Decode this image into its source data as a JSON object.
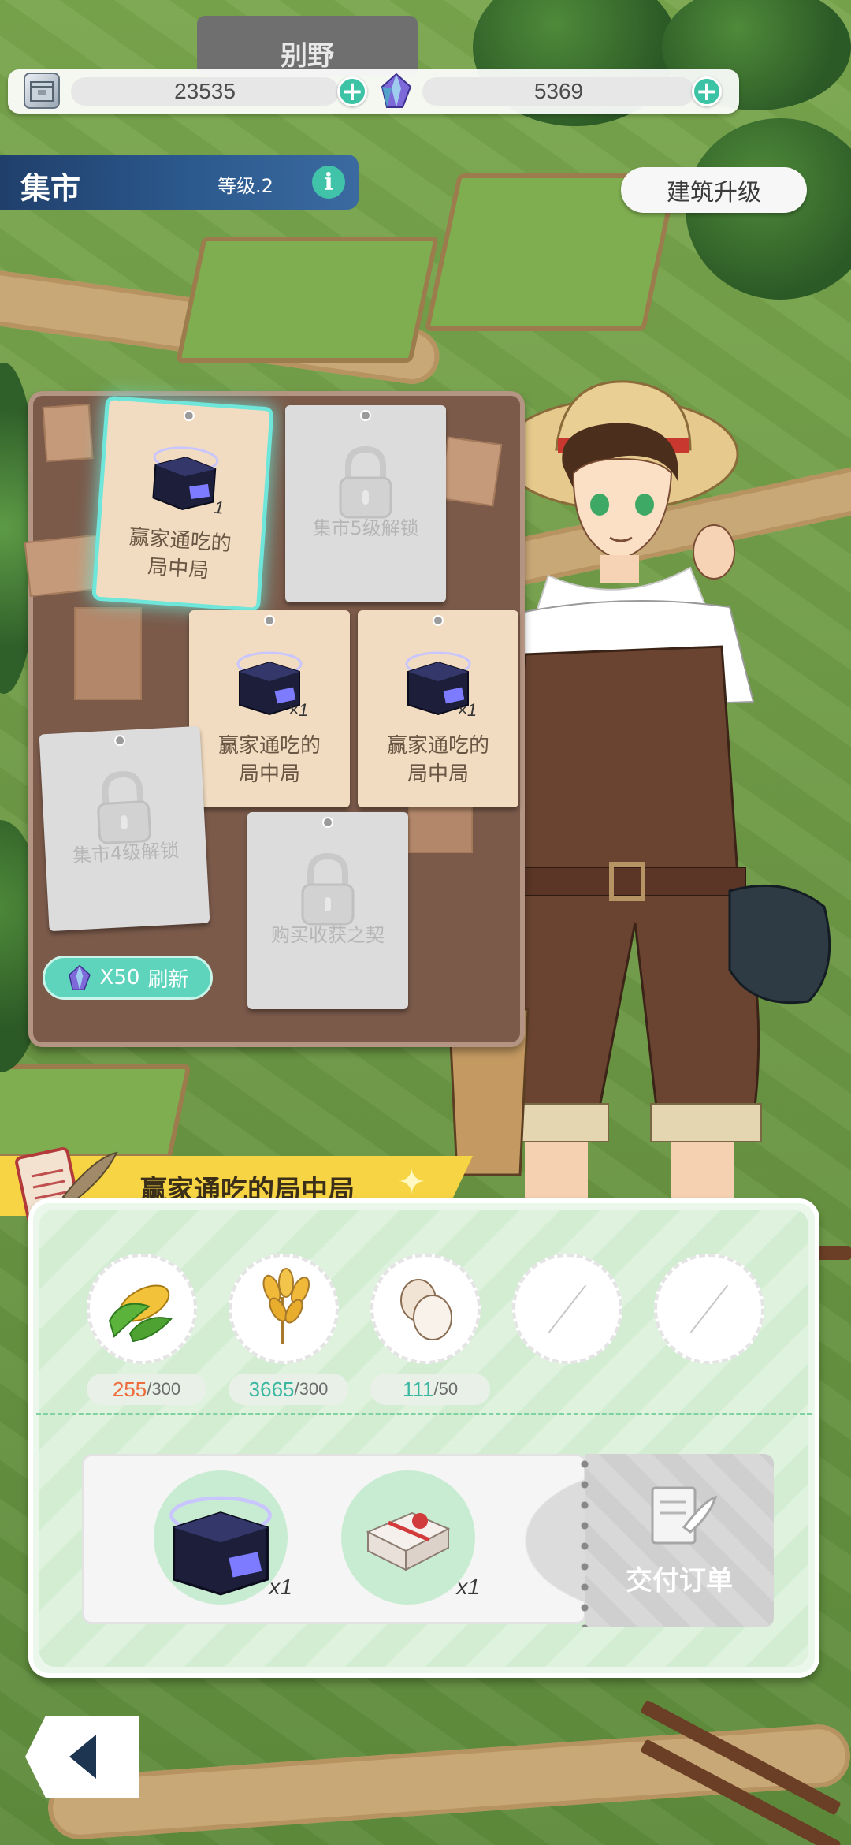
{
  "resources": {
    "boxes": {
      "value": "23535",
      "icon": "storage-box-icon"
    },
    "crystals": {
      "value": "5369",
      "icon": "crystal-icon"
    }
  },
  "location": {
    "name": "集市",
    "level": "等级.2",
    "info_icon": "i"
  },
  "header_sign": "别野",
  "upgrade_button": "建筑升级",
  "board": {
    "cards": [
      {
        "label": "赢家通吃的局中局",
        "qty": "1",
        "state": "selected"
      },
      {
        "label": "集市5级解锁",
        "state": "locked"
      },
      {
        "label": "赢家通吃的局中局",
        "qty": "×1",
        "state": "open"
      },
      {
        "label": "赢家通吃的局中局",
        "qty": "×1",
        "state": "open"
      },
      {
        "label": "集市4级解锁",
        "state": "locked"
      },
      {
        "label": "购买收获之契",
        "state": "locked"
      }
    ],
    "refresh": {
      "cost": "X50",
      "label": "刷新"
    }
  },
  "order": {
    "title": "赢家通吃的局中局",
    "requirements": [
      {
        "item": "corn-icon",
        "have": "255",
        "need": "/300",
        "have_color": "#ef6b3a"
      },
      {
        "item": "wheat-icon",
        "have": "3665",
        "need": "/300",
        "have_color": "#39b7a0"
      },
      {
        "item": "egg-icon",
        "have": "111",
        "need": "/50",
        "have_color": "#39b7a0"
      },
      {
        "item": "empty-slot",
        "have": "",
        "need": ""
      },
      {
        "item": "empty-slot",
        "have": "",
        "need": ""
      }
    ],
    "rewards": [
      {
        "item": "mystery-gift-box-icon",
        "qty": "x1"
      },
      {
        "item": "wrapped-package-icon",
        "qty": "x1"
      }
    ],
    "deliver_button": "交付订单"
  },
  "colors": {
    "accent_teal": "#3cc3a5",
    "header_blue": "#2c5a8f",
    "ribbon_yellow": "#f6d443"
  }
}
